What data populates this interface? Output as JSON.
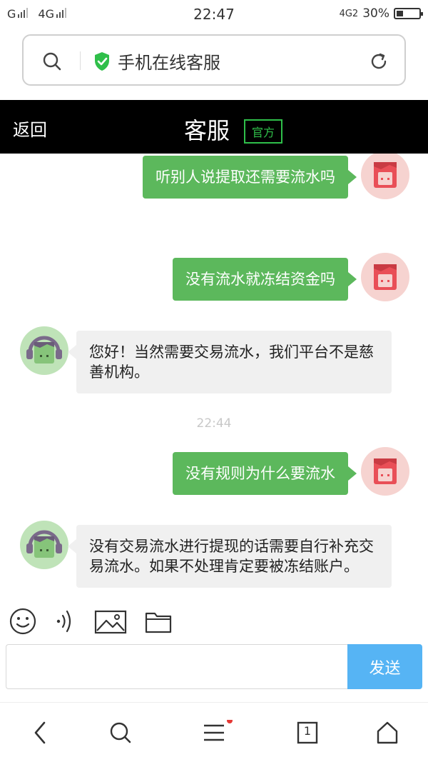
{
  "status_bar": {
    "carrier1": "G",
    "carrier2": "4G",
    "time": "22:47",
    "net": "4G2",
    "battery": "30%",
    "battery_fraction": 0.3
  },
  "address_bar": {
    "title": "手机在线客服"
  },
  "header": {
    "back_label": "返回",
    "title": "客服",
    "badge": "官方"
  },
  "chat": {
    "timestamp": "22:44",
    "messages": [
      {
        "side": "out",
        "text": "听别人说提取还需要流水吗"
      },
      {
        "side": "out",
        "text": "没有流水就冻结资金吗"
      },
      {
        "side": "in",
        "text": "您好！当然需要交易流水，我们平台不是慈善机构。"
      },
      {
        "side": "out",
        "text": "没有规则为什么要流水"
      },
      {
        "side": "in",
        "text": "没有交易流水进行提现的话需要自行补充交易流水。如果不处理肯定要被冻结账户。"
      }
    ]
  },
  "toolbar": {
    "icons": [
      "emoji-icon",
      "voice-icon",
      "image-icon",
      "folder-icon"
    ]
  },
  "input": {
    "value": "",
    "placeholder": "",
    "send_label": "发送"
  },
  "bottom_nav": {
    "tab_count": "1"
  },
  "colors": {
    "outgoing_bubble": "#5cb85c",
    "incoming_bubble": "#f0f0f0",
    "send_button": "#56b4f4",
    "header_bg": "#000000",
    "badge_green": "#2fbf4a"
  }
}
